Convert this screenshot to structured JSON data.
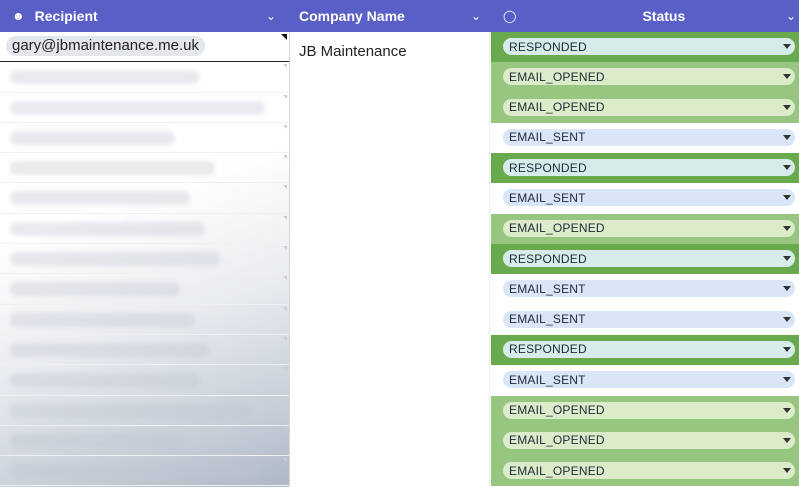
{
  "header": {
    "recipient_label": "Recipient",
    "company_label": "Company Name",
    "status_label": "Status",
    "icons": [
      "person-icon",
      "chevron-down-icon",
      "pill-icon"
    ]
  },
  "recipient": {
    "first_value": "gary@jbmaintenance.me.uk",
    "hidden_row_count": 14
  },
  "company": {
    "first_value": "JB Maintenance"
  },
  "status_rows": [
    {
      "value": "RESPONDED",
      "kind": "r"
    },
    {
      "value": "EMAIL_OPENED",
      "kind": "o"
    },
    {
      "value": "EMAIL_OPENED",
      "kind": "o"
    },
    {
      "value": "EMAIL_SENT",
      "kind": "s"
    },
    {
      "value": "RESPONDED",
      "kind": "r"
    },
    {
      "value": "EMAIL_SENT",
      "kind": "s"
    },
    {
      "value": "EMAIL_OPENED",
      "kind": "o"
    },
    {
      "value": "RESPONDED",
      "kind": "r"
    },
    {
      "value": "EMAIL_SENT",
      "kind": "s"
    },
    {
      "value": "EMAIL_SENT",
      "kind": "s"
    },
    {
      "value": "RESPONDED",
      "kind": "r"
    },
    {
      "value": "EMAIL_SENT",
      "kind": "s"
    },
    {
      "value": "EMAIL_OPENED",
      "kind": "o"
    },
    {
      "value": "EMAIL_OPENED",
      "kind": "o"
    },
    {
      "value": "EMAIL_OPENED",
      "kind": "o"
    }
  ],
  "colors": {
    "header_bg": "#5a5fc8",
    "responded_row": "#6aaa4e",
    "opened_row": "#97c680",
    "sent_pill": "#d9e6f8"
  }
}
